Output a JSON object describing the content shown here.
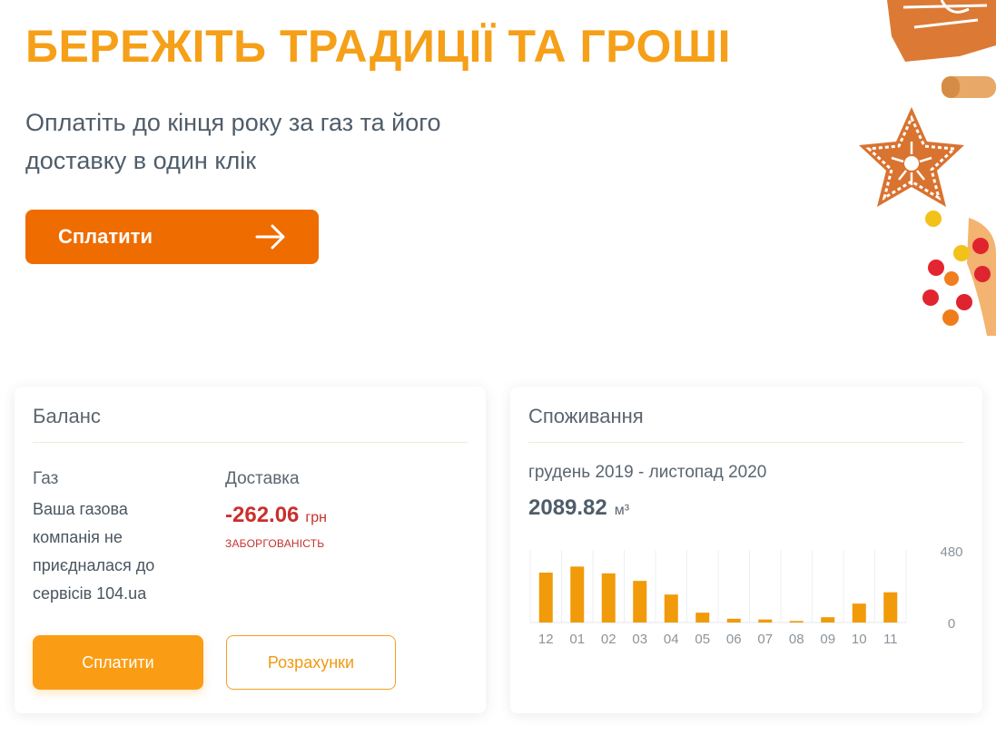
{
  "hero": {
    "title": "БЕРЕЖІТЬ ТРАДИЦІЇ ТА ГРОШІ",
    "subtitle": "Оплатіть до кінця року за газ та його доставку в один клік",
    "pay_label": "Сплатити"
  },
  "balance": {
    "title": "Баланс",
    "gas_label": "Газ",
    "gas_note": "Ваша газова компанія не приєдналася до сервісів 104.ua",
    "delivery_label": "Доставка",
    "delivery_amount": "-262.06",
    "currency": "грн",
    "debt_label": "ЗАБОРГОВАНІСТЬ",
    "pay_label": "Сплатити",
    "calc_label": "Розрахунки"
  },
  "consumption": {
    "title": "Споживання",
    "period": "грудень 2019 - листопад 2020",
    "total": "2089.82",
    "unit": "м³"
  },
  "chart_data": {
    "type": "bar",
    "categories": [
      "12",
      "01",
      "02",
      "03",
      "04",
      "05",
      "06",
      "07",
      "08",
      "09",
      "10",
      "11"
    ],
    "values": [
      330,
      370,
      325,
      275,
      185,
      65,
      25,
      20,
      10,
      35,
      125,
      200
    ],
    "ylim": [
      0,
      480
    ],
    "yticks": [
      "480",
      "0"
    ],
    "bar_color": "#f19a0a",
    "grid": true
  },
  "colors": {
    "accent": "#f5a018",
    "hero_button": "#ef6c00",
    "pay_button": "#fb9d14",
    "debt": "#c9302c"
  },
  "icons": {
    "hero_button": "arrow-right-icon"
  }
}
